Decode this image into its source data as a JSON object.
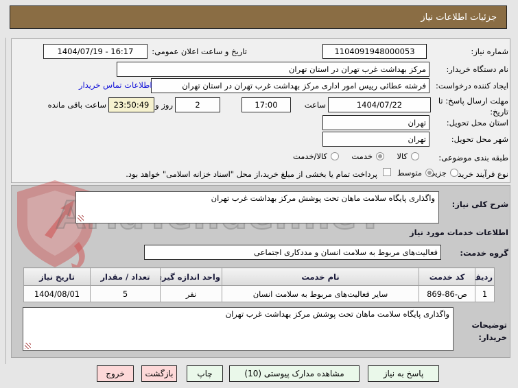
{
  "title": "جزئیات اطلاعات نیاز",
  "watermark": {
    "brand": "AriaTender.neT"
  },
  "colors": {
    "header_bg": "#8a6d44",
    "link": "#0f0fd8",
    "remaining_highlight": "#f6f2cf",
    "button_green": "#eaf8ea",
    "button_pink": "#fdd8d8",
    "section2_bg": "#c9c9c9"
  },
  "fields": {
    "need_no_label": "شماره نیاز:",
    "need_no_value": "1104091948000053",
    "announce_label": "تاریخ و ساعت اعلان عمومی:",
    "announce_value": "1404/07/19 - 16:17",
    "buyer_org_label": "نام دستگاه خریدار:",
    "buyer_org_value": "مرکز بهداشت غرب تهران در استان تهران",
    "creator_label": "ایجاد کننده درخواست:",
    "creator_value": "فرشته عطائی رییس امور اداری مرکز بهداشت غرب تهران در استان تهران",
    "contact_link": "اطلاعات تماس خریدار",
    "deadline_label": "مهلت ارسال پاسخ: تا تاریخ:",
    "deadline_date": "1404/07/22",
    "hour_label": "ساعت",
    "deadline_time": "17:00",
    "days_value": "2",
    "days_label": "روز و",
    "remaining_value": "23:50:49",
    "remaining_label": "ساعت باقی مانده",
    "province_label": "استان محل تحویل:",
    "province_value": "تهران",
    "city_label": "شهر محل تحویل:",
    "city_value": "تهران"
  },
  "classification": {
    "subject_label": "طبقه بندی موضوعی:",
    "subject_options": [
      {
        "label": "کالا",
        "selected": false
      },
      {
        "label": "خدمت",
        "selected": true
      },
      {
        "label": "کالا/خدمت",
        "selected": false
      }
    ],
    "subject_selected": "خدمت",
    "process_label": "نوع فرآیند خرید :",
    "process_options": [
      {
        "label": "جزیی",
        "selected": false
      },
      {
        "label": "متوسط",
        "selected": true
      }
    ],
    "process_selected": "متوسط",
    "treasury_note": "پرداخت تمام یا بخشی از مبلغ خرید،از محل \"اسناد خزانه اسلامی\" خواهد بود.",
    "treasury_checked": false
  },
  "need_desc": {
    "label": "شرح کلی نیاز:",
    "value": "واگذاری پایگاه سلامت ماهان تحت پوشش مرکز بهداشت غرب تهران"
  },
  "services": {
    "heading": "اطلاعات خدمات مورد نیاز",
    "group_label": "گروه خدمت:",
    "group_value": "فعالیت‌های مربوط به سلامت انسان و مددکاری اجتماعی",
    "table": {
      "headers": [
        "ردیف",
        "کد خدمت",
        "نام خدمت",
        "واحد اندازه گیری",
        "تعداد / مقدار",
        "تاریخ نیاز"
      ],
      "rows": [
        [
          "1",
          "ص-86-869",
          "سایر فعالیت‌های مربوط به سلامت انسان",
          "نفر",
          "5",
          "1404/08/01"
        ]
      ]
    }
  },
  "buyer_notes": {
    "label": "توضیحات خریدار:",
    "value": "واگذاری پایگاه سلامت ماهان تحت پوشش مرکز بهداشت غرب تهران"
  },
  "buttons": {
    "reply": "پاسخ به نیاز",
    "attachments": "مشاهده مدارک پیوستی (10)",
    "print": "چاپ",
    "back": "بازگشت",
    "exit": "خروج"
  }
}
